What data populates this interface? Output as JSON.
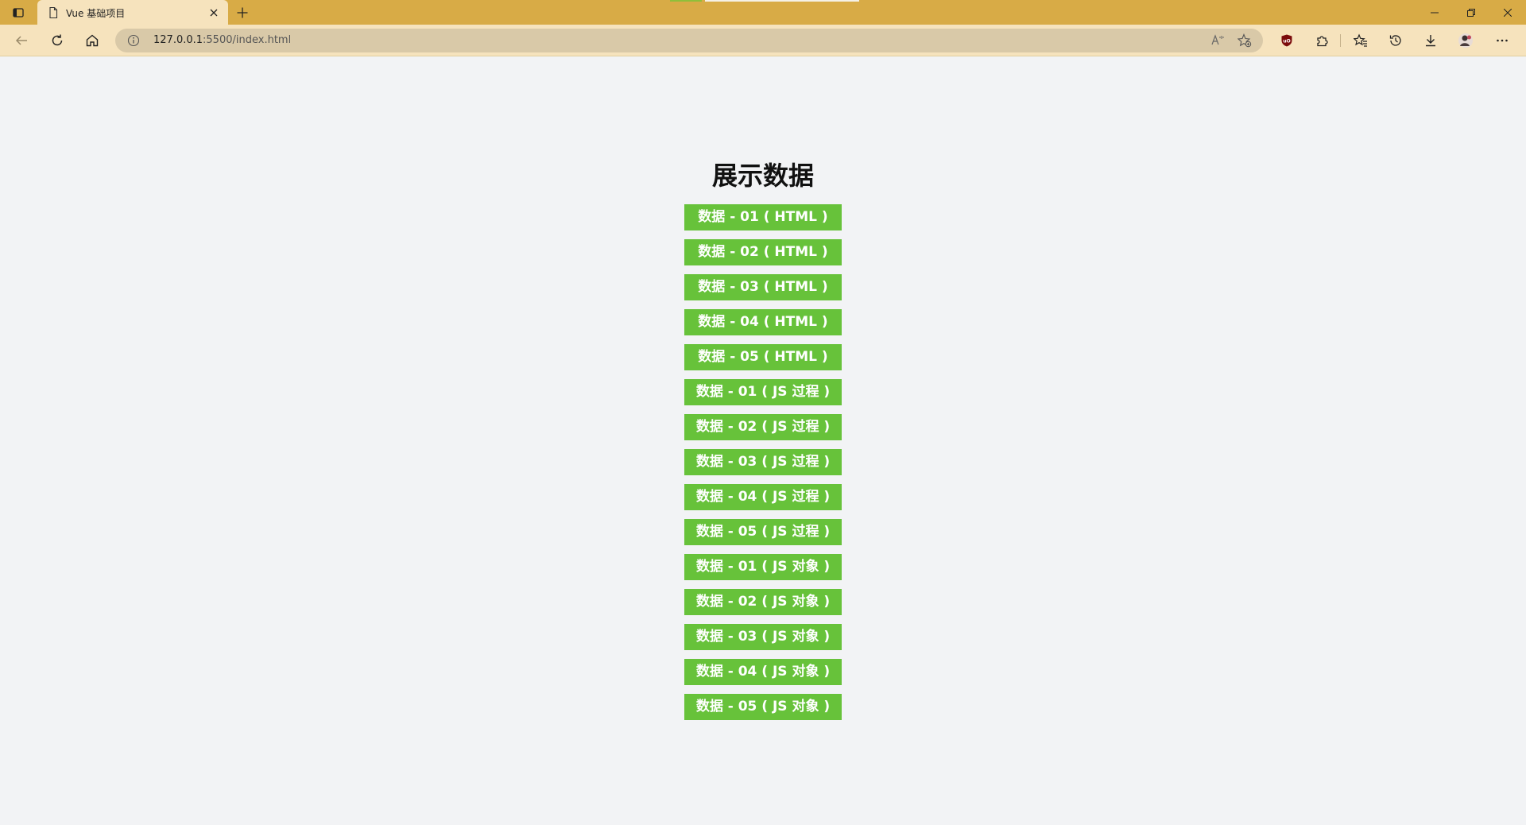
{
  "browser": {
    "tab": {
      "title": "Vue 基础项目",
      "close_glyph": "✕"
    },
    "new_tab_glyph": "+",
    "window_controls": {
      "minimize_glyph": "─",
      "restore_glyph": "❐",
      "close_glyph": "✕"
    },
    "address_bar": {
      "url_host": "127.0.0.1",
      "url_rest": ":5500/index.html"
    },
    "icons": {
      "tab_actions": "tab-actions-icon",
      "back": "back-arrow-icon",
      "reload": "reload-icon",
      "home": "home-icon",
      "site_info": "info-icon",
      "read_aloud": "read-aloud-icon",
      "add_favorite": "add-favorite-icon",
      "ublock": "ublock-extension-icon",
      "extensions": "extensions-icon",
      "favorites": "favorites-icon",
      "history": "history-icon",
      "downloads": "downloads-icon",
      "profile": "profile-avatar",
      "more": "more-menu-icon"
    }
  },
  "page": {
    "heading": "展示数据",
    "items": [
      "数据 - 01 ( HTML )",
      "数据 - 02 ( HTML )",
      "数据 - 03 ( HTML )",
      "数据 - 04 ( HTML )",
      "数据 - 05 ( HTML )",
      "数据 - 01 ( JS 过程 )",
      "数据 - 02 ( JS 过程 )",
      "数据 - 03 ( JS 过程 )",
      "数据 - 04 ( JS 过程 )",
      "数据 - 05 ( JS 过程 )",
      "数据 - 01 ( JS 对象 )",
      "数据 - 02 ( JS 对象 )",
      "数据 - 03 ( JS 对象 )",
      "数据 - 04 ( JS 对象 )",
      "数据 - 05 ( JS 对象 )"
    ]
  },
  "colors": {
    "tabstrip": "#d8ab46",
    "toolbar": "#f6e3bd",
    "button_green": "#67c23a",
    "page_background": "#f2f3f5"
  }
}
